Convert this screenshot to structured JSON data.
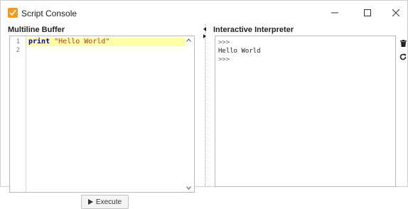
{
  "window": {
    "title": "Script Console"
  },
  "left_pane": {
    "title": "Multiline Buffer",
    "line_numbers": [
      "1",
      "2"
    ],
    "code": {
      "keyword": "print",
      "string": "\"Hello World\""
    },
    "execute_label": "Execute"
  },
  "right_pane": {
    "title": "Interactive Interpreter",
    "output_lines": [
      ">>>",
      "Hello World",
      ">>>"
    ]
  },
  "icons": {
    "app": "script-console-icon",
    "minimize": "minimize-icon",
    "maximize": "maximize-icon",
    "close": "close-icon",
    "clear": "trash-icon",
    "reset": "refresh-icon",
    "execute": "play-icon"
  },
  "colors": {
    "app_icon": "#f39a1c",
    "highlight_line": "#ffffaa",
    "keyword": "#0000c0",
    "string": "#c0392b"
  }
}
